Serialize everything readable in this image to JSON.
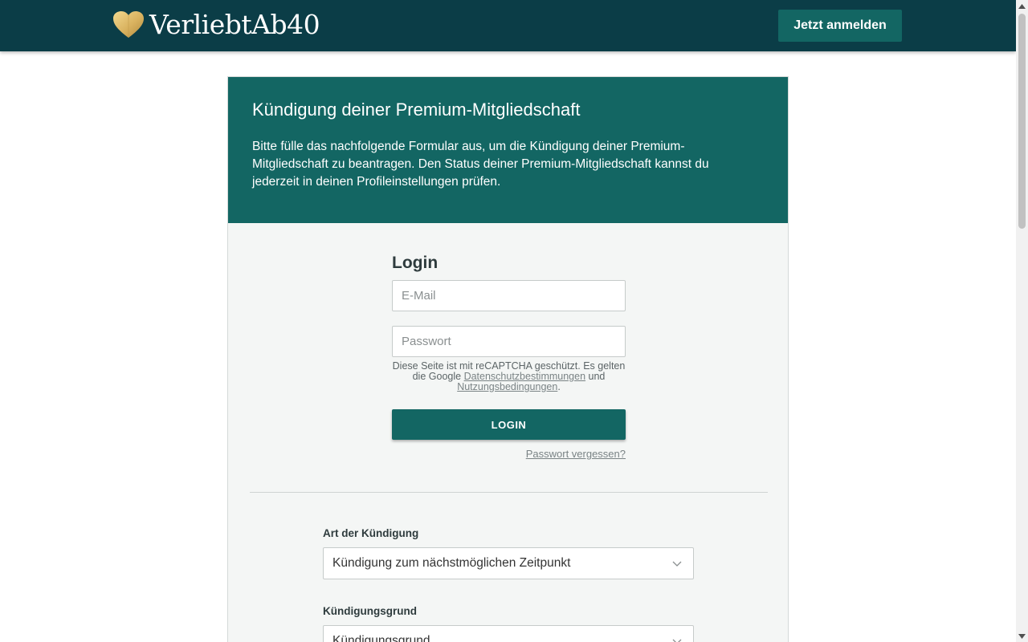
{
  "header": {
    "logo_text": "VerliebtAb40",
    "signup_button": "Jetzt anmelden"
  },
  "card": {
    "title": "Kündigung deiner Premium-Mitgliedschaft",
    "description": "Bitte fülle das nachfolgende Formular aus, um die Kündigung deiner Premium-Mitgliedschaft zu beantragen. Den Status deiner Premium-Mitgliedschaft kannst du jederzeit in deinen Profileinstellungen prüfen."
  },
  "login": {
    "title": "Login",
    "email_placeholder": "E-Mail",
    "password_placeholder": "Passwort",
    "recaptcha_prefix": "Diese Seite ist mit reCAPTCHA geschützt. Es gelten die Google",
    "privacy_link": "Datenschutzbestimmungen",
    "recaptcha_and": "und",
    "terms_link": "Nutzungsbedingungen",
    "recaptcha_suffix": ".",
    "login_button": "LOGIN",
    "forgot_password": "Passwort vergessen?"
  },
  "form": {
    "type_label": "Art der Kündigung",
    "type_value": "Kündigung zum nächstmöglichen Zeitpunkt",
    "reason_label": "Kündigungsgrund",
    "reason_value": "Kündigungsgrund"
  },
  "colors": {
    "topbar": "#0b3d47",
    "accent": "#136663",
    "logo_heart": "#d9b25f"
  },
  "icons": {
    "logo": "heart-icon",
    "select": "chevron-down-icon",
    "scroll_up": "arrow-up-icon",
    "scroll_down": "arrow-down-icon"
  }
}
